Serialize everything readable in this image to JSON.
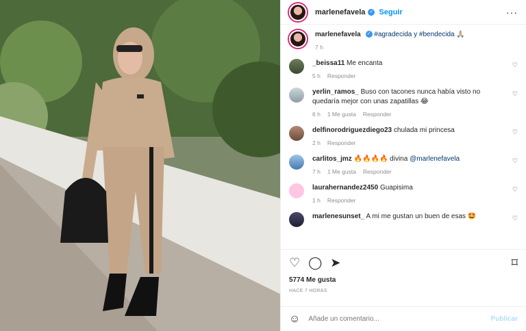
{
  "header": {
    "username": "marlenefavela",
    "follow_label": "Seguir",
    "more_label": "···"
  },
  "caption": {
    "username": "marlenefavela",
    "text": "#agradecida y #bendecida 🙏🏼",
    "time": "7 h"
  },
  "comments": [
    {
      "user": "_beissa11",
      "text": "Me encanta",
      "time": "5 h",
      "likes": "",
      "reply": "Responder",
      "thumb": "thumb-a"
    },
    {
      "user": "yerlin_ramos_",
      "text": "Buso con tacones nunca había visto no quedaría mejor con unas zapatillas 😂",
      "time": "6 h",
      "likes": "1 Me gusta",
      "reply": "Responder",
      "thumb": "thumb-b"
    },
    {
      "user": "delfinorodriguezdiego23",
      "text": "chulada mi princesa",
      "time": "2 h",
      "likes": "",
      "reply": "Responder",
      "thumb": "thumb-c"
    },
    {
      "user": "carlitos_jmz",
      "text": "🔥🔥🔥🔥 divina",
      "mention": "@marlenefavela",
      "time": "7 h",
      "likes": "1 Me gusta",
      "reply": "Responder",
      "thumb": "thumb-d"
    },
    {
      "user": "laurahernandez2450",
      "text": "Guapisima",
      "time": "1 h",
      "likes": "",
      "reply": "Responder",
      "thumb": "thumb-e"
    },
    {
      "user": "marlenesunset_",
      "text": "A mi me gustan un buen de esas 🤩",
      "time": "",
      "likes": "",
      "reply": "",
      "thumb": "thumb-f"
    }
  ],
  "likes": "5774 Me gusta",
  "time_ago": "HACE 7 HORAS",
  "add_comment": {
    "placeholder": "Añade un comentario...",
    "publish_label": "Publicar"
  },
  "icons": {
    "like": "heart-icon",
    "comment": "comment-icon",
    "share": "share-icon",
    "save": "bookmark-icon",
    "emoji": "emoji-icon",
    "more": "more-icon",
    "verified": "verified-icon"
  },
  "colors": {
    "accent": "#0095f6",
    "verified": "#3897f0",
    "muted": "#8e8e8e",
    "publish_disabled": "#b2dffc"
  }
}
